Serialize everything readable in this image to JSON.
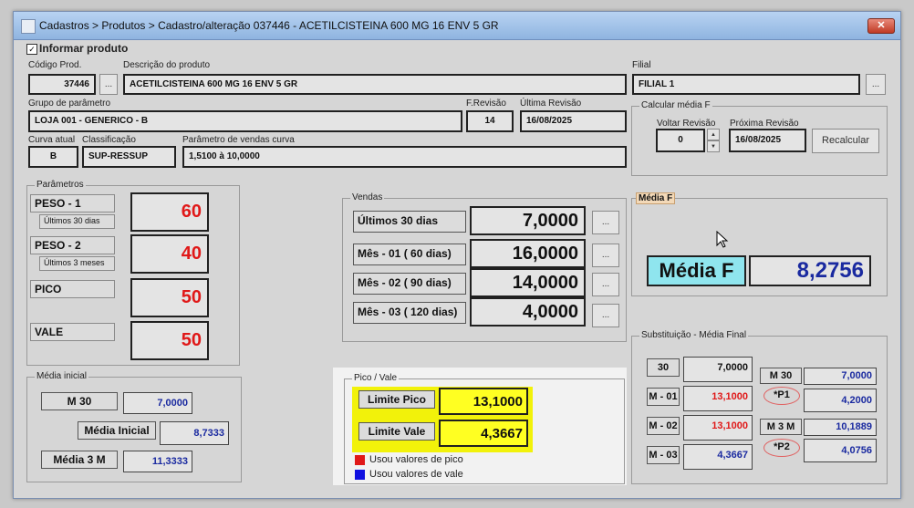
{
  "window": {
    "title": "Cadastros > Produtos > Cadastro/alteração  037446 - ACETILCISTEINA 600 MG 16 ENV 5 GR",
    "close_glyph": "✕"
  },
  "header": {
    "checkbox_label": "Informar produto",
    "codigo_label": "Código Prod.",
    "codigo_value": "37446",
    "descricao_label": "Descrição do  produto",
    "descricao_value": "ACETILCISTEINA 600 MG 16 ENV 5 GR",
    "filial_label": "Filial",
    "filial_value": "FILIAL 1",
    "grupo_label": "Grupo de parâmetro",
    "grupo_value": "LOJA 001 - GENERICO - B",
    "frevisao_label": "F.Revisão",
    "frevisao_value": "14",
    "ultima_label": "Última Revisão",
    "ultima_value": "16/08/2025",
    "curva_label": "Curva atual",
    "curva_value": "B",
    "classificacao_label": "Classificação",
    "classificacao_value": "SUP-RESSUP",
    "parametro_label": "Parâmetro de vendas curva",
    "parametro_value": "1,5100   à   10,0000",
    "ellipsis": "..."
  },
  "calcular": {
    "group_label": "Calcular média F",
    "voltar_label": "Voltar Revisão",
    "voltar_value": "0",
    "proxima_label": "Próxima Revisão",
    "proxima_value": "16/08/2025",
    "recalcular_label": "Recalcular",
    "spin_up": "▲",
    "spin_down": "▼"
  },
  "parametros": {
    "group_label": "Parâmetros",
    "peso1_label": "PESO - 1",
    "peso1_sub": "Últimos 30 dias",
    "peso1_value": "60",
    "peso2_label": "PESO - 2",
    "peso2_sub": "Últimos 3 meses",
    "peso2_value": "40",
    "pico_label": "PICO",
    "pico_value": "50",
    "vale_label": "VALE",
    "vale_value": "50"
  },
  "vendas": {
    "group_label": "Vendas",
    "rows": [
      {
        "label": "Últimos 30 dias",
        "value": "7,0000"
      },
      {
        "label": "Mês - 01 ( 60 dias)",
        "value": "16,0000"
      },
      {
        "label": "Mês - 02 ( 90 dias)",
        "value": "14,0000"
      },
      {
        "label": "Mês - 03 ( 120 dias)",
        "value": "4,0000"
      }
    ]
  },
  "media_f": {
    "group_label": "Média F",
    "label": "Média F",
    "value": "8,2756"
  },
  "media_inicial": {
    "group_label": "Média inicial",
    "m30_label": "M 30",
    "m30_value": "7,0000",
    "inicial_label": "Média Inicial",
    "inicial_value": "8,7333",
    "m3m_label": "Média 3 M",
    "m3m_value": "11,3333"
  },
  "pico_vale": {
    "group_label": "Pico / Vale",
    "limite_pico_label": "Limite Pico",
    "limite_pico_value": "13,1000",
    "limite_vale_label": "Limite Vale",
    "limite_vale_value": "4,3667",
    "legend_pico": "Usou valores de pico",
    "legend_vale": "Usou valores de vale",
    "color_pico": "#e01818",
    "color_vale": "#1010e0",
    "highlight": "#f2f20a"
  },
  "substituicao": {
    "group_label": "Substituição - Média Final",
    "left_rows": [
      {
        "label": "30",
        "value": "7,0000",
        "color": "black"
      },
      {
        "label": "M - 01",
        "value": "13,1000",
        "color": "red"
      },
      {
        "label": "M - 02",
        "value": "13,1000",
        "color": "red"
      },
      {
        "label": "M - 03",
        "value": "4,3667",
        "color": "blue"
      }
    ],
    "right_rows": [
      {
        "label": "M 30",
        "value": "7,0000"
      },
      {
        "label": "*P1",
        "value": "4,2000"
      },
      {
        "label": "M 3 M",
        "value": "10,1889"
      },
      {
        "label": "*P2",
        "value": "4,0756"
      }
    ]
  }
}
